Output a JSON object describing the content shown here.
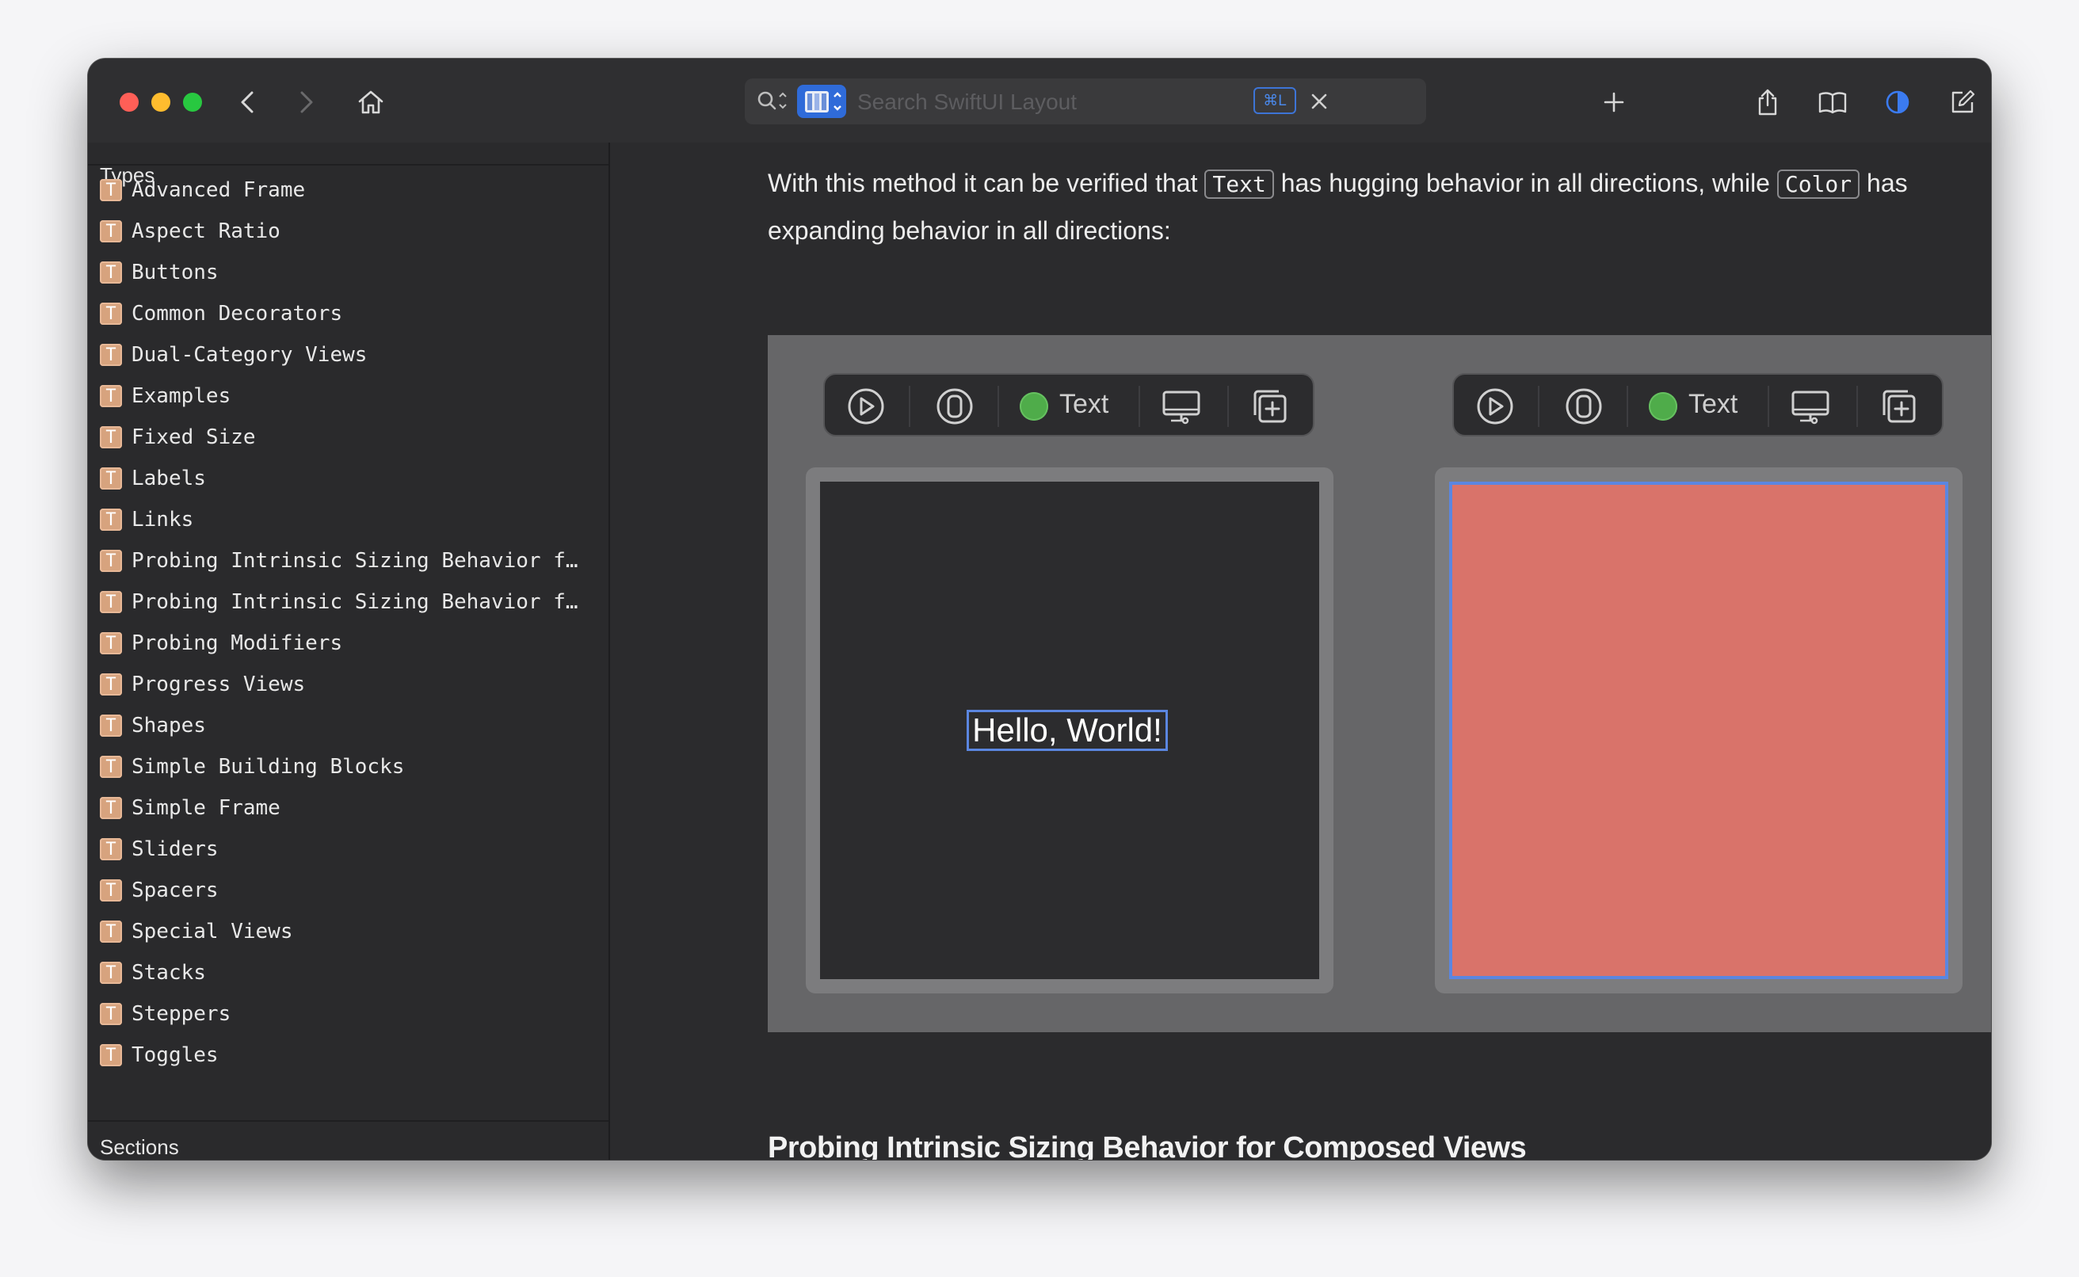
{
  "search": {
    "placeholder": "Search SwiftUI Layout",
    "shortcut": "⌘L"
  },
  "sidebar": {
    "types_header": "Types",
    "sections_header": "Sections",
    "item_icon_glyph": "T",
    "items": [
      "Advanced Frame",
      "Aspect Ratio",
      "Buttons",
      "Common Decorators",
      "Dual-Category Views",
      "Examples",
      "Fixed Size",
      "Labels",
      "Links",
      "Probing Intrinsic Sizing Behavior f…",
      "Probing Intrinsic Sizing Behavior f…",
      "Probing Modifiers",
      "Progress Views",
      "Shapes",
      "Simple Building Blocks",
      "Simple Frame",
      "Sliders",
      "Spacers",
      "Special Views",
      "Stacks",
      "Steppers",
      "Toggles"
    ]
  },
  "content": {
    "para_part1": "With this method it can be verified that ",
    "code1": "Text",
    "para_part2": " has hugging behavior in all directions, while ",
    "code2": "Color",
    "para_part3": " has expanding behavior in all directions:",
    "heading": "Probing Intrinsic Sizing Behavior for Composed Views"
  },
  "demo": {
    "left": {
      "toolbar_label": "Text",
      "preview_text": "Hello, World!",
      "preview_bg": "#2c2c2e"
    },
    "right": {
      "toolbar_label": "Text",
      "preview_bg": "#d9736a",
      "preview_border": "#5b86e0"
    }
  },
  "colors": {
    "accent": "#2f6bd9",
    "live_dot": "#4fac4a",
    "type_icon": "#d7a37e"
  }
}
